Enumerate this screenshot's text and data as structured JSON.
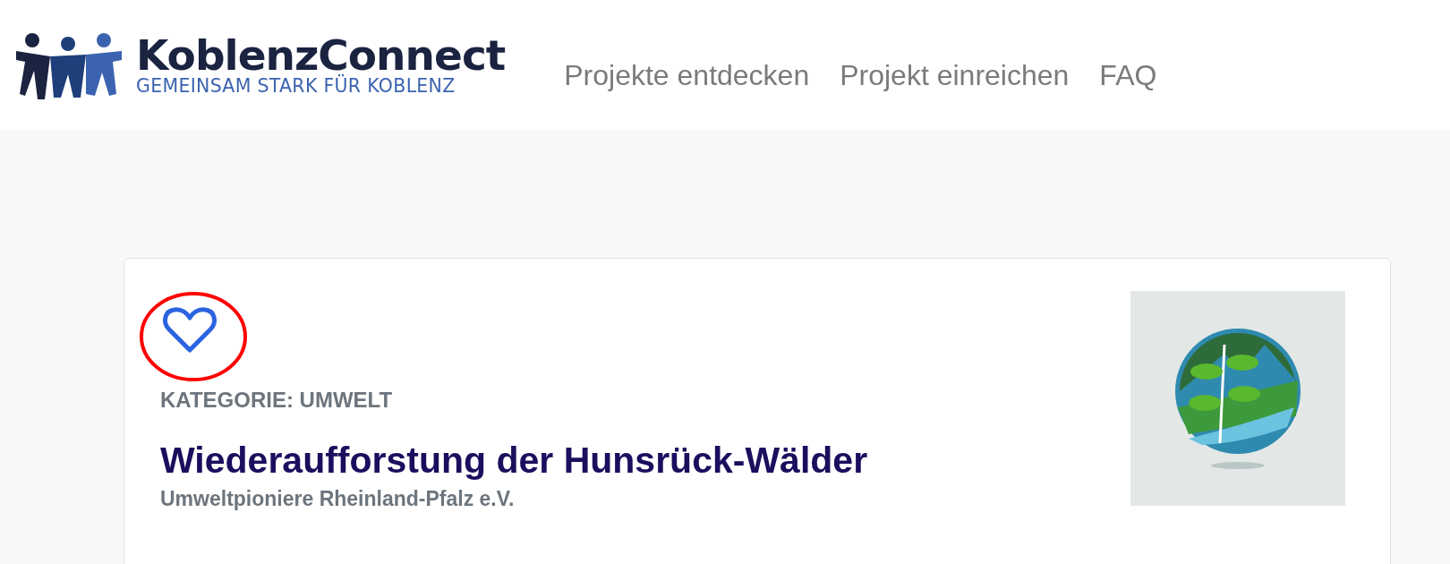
{
  "header": {
    "brand": "KoblenzConnect",
    "tagline": "GEMEINSAM STARK FÜR KOBLENZ",
    "nav": [
      {
        "label": "Projekte entdecken"
      },
      {
        "label": "Projekt einreichen"
      },
      {
        "label": "FAQ"
      }
    ]
  },
  "project": {
    "favorited": false,
    "highlighted": true,
    "category": "KATEGORIE: UMWELT",
    "title": "Wiederaufforstung der Hunsrück-Wälder",
    "organization": "Umweltpioniere Rheinland-Pfalz e.V."
  }
}
